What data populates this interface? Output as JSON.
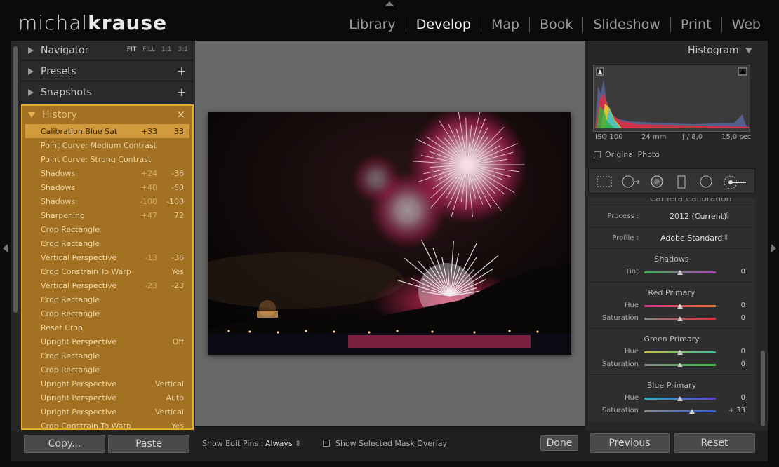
{
  "app": {
    "logo_part1": "michal",
    "logo_part2": "krause"
  },
  "modules": [
    "Library",
    "Develop",
    "Map",
    "Book",
    "Slideshow",
    "Print",
    "Web"
  ],
  "active_module": "Develop",
  "left_panel": {
    "navigator": {
      "title": "Navigator",
      "options": [
        "FIT",
        "FILL",
        "1:1",
        "3:1"
      ]
    },
    "presets": {
      "title": "Presets",
      "add": "+"
    },
    "snapshots": {
      "title": "Snapshots",
      "add": "+"
    },
    "history": {
      "title": "History",
      "clear": "×",
      "items": [
        {
          "label": "Calibration Blue Sat",
          "before": "+33",
          "after": "33",
          "selected": true
        },
        {
          "label": "Point Curve: Medium Contrast",
          "before": "",
          "after": ""
        },
        {
          "label": "Point Curve: Strong Contrast",
          "before": "",
          "after": ""
        },
        {
          "label": "Shadows",
          "before": "+24",
          "after": "-36"
        },
        {
          "label": "Shadows",
          "before": "+40",
          "after": "-60"
        },
        {
          "label": "Shadows",
          "before": "-100",
          "after": "-100"
        },
        {
          "label": "Sharpening",
          "before": "+47",
          "after": "72"
        },
        {
          "label": "Crop Rectangle",
          "before": "",
          "after": ""
        },
        {
          "label": "Crop Rectangle",
          "before": "",
          "after": ""
        },
        {
          "label": "Vertical Perspective",
          "before": "-13",
          "after": "-36"
        },
        {
          "label": "Crop Constrain To Warp",
          "before": "",
          "after": "Yes"
        },
        {
          "label": "Vertical Perspective",
          "before": "-23",
          "after": "-23"
        },
        {
          "label": "Crop Rectangle",
          "before": "",
          "after": ""
        },
        {
          "label": "Crop Rectangle",
          "before": "",
          "after": ""
        },
        {
          "label": "Reset Crop",
          "before": "",
          "after": ""
        },
        {
          "label": "Upright Perspective",
          "before": "",
          "after": "Off"
        },
        {
          "label": "Crop Rectangle",
          "before": "",
          "after": ""
        },
        {
          "label": "Crop Rectangle",
          "before": "",
          "after": ""
        },
        {
          "label": "Upright Perspective",
          "before": "",
          "after": "Vertical"
        },
        {
          "label": "Upright Perspective",
          "before": "",
          "after": "Auto"
        },
        {
          "label": "Upright Perspective",
          "before": "",
          "after": "Vertical"
        },
        {
          "label": "Crop Constrain To Warp",
          "before": "",
          "after": "Yes"
        }
      ]
    },
    "copy_label": "Copy...",
    "paste_label": "Paste"
  },
  "toolbar": {
    "edit_pins_label": "Show Edit Pins :",
    "edit_pins_value": "Always",
    "mask_overlay_label": "Show Selected Mask Overlay",
    "done_label": "Done"
  },
  "right_panel": {
    "histogram_title": "Histogram",
    "iso": "ISO 100",
    "focal": "24 mm",
    "aperture": "ƒ / 8,0",
    "shutter": "15,0 sec",
    "original_photo": "Original Photo",
    "camera_calibration_title": "Camera Calibration",
    "process_label": "Process :",
    "process_value": "2012 (Current)",
    "profile_label": "Profile :",
    "profile_value": "Adobe Standard",
    "shadows": {
      "title": "Shadows",
      "tint_label": "Tint",
      "tint_value": "0",
      "tint_pos": 0.5
    },
    "red": {
      "title": "Red Primary",
      "hue_label": "Hue",
      "hue_value": "0",
      "hue_pos": 0.5,
      "sat_label": "Saturation",
      "sat_value": "0",
      "sat_pos": 0.5
    },
    "green": {
      "title": "Green Primary",
      "hue_label": "Hue",
      "hue_value": "0",
      "hue_pos": 0.5,
      "sat_label": "Saturation",
      "sat_value": "0",
      "sat_pos": 0.5
    },
    "blue": {
      "title": "Blue Primary",
      "hue_label": "Hue",
      "hue_value": "0",
      "hue_pos": 0.5,
      "sat_label": "Saturation",
      "sat_value": "+ 33",
      "sat_pos": 0.665
    },
    "previous_label": "Previous",
    "reset_label": "Reset"
  },
  "colors": {
    "history_bg": "#a27122",
    "history_border": "#e6a92a",
    "history_selected": "#d09a3d"
  }
}
